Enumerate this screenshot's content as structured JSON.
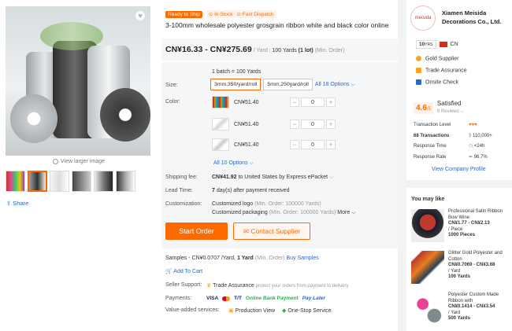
{
  "gallery": {
    "view_larger": "View larger image",
    "share": "Share"
  },
  "product": {
    "badge_ready": "Ready to Ship",
    "badge_stock": "In Stock",
    "badge_dispatch": "Fast Dispatch",
    "title": "3-100mm wholesale polyester grosgrain ribbon white and black color online",
    "price_range": "CN¥16.33 - CN¥275.69",
    "price_unit": "/ Yard",
    "moq_qty": "100 Yards",
    "moq_lot": "(1 lot)",
    "moq_note": "(Min. Order)"
  },
  "options": {
    "batch": "1 batch = 100 Yards",
    "size_label": "Size:",
    "sizes": [
      "3mm,350/yard/roll",
      "5mm,250yard/roll"
    ],
    "all_sizes": "All 18 Options",
    "color_label": "Color:",
    "colors": [
      {
        "price": "CN¥51.40",
        "qty": "0"
      },
      {
        "price": "CN¥51.40",
        "qty": "0"
      },
      {
        "price": "CN¥51.40",
        "qty": "0"
      }
    ],
    "all_colors": "All 10 Options",
    "shipping_label": "Shipping fee:",
    "shipping_price": "CN¥41.92",
    "shipping_text": "to United States by Express ePacket",
    "lead_label": "Lead Time:",
    "lead_days": "7",
    "lead_text": "day(s) after payment received",
    "custom_label": "Customization:",
    "custom_logo": "Customized logo",
    "custom_logo_note": "(Min. Order: 100000 Yards)",
    "custom_pack": "Customized packaging",
    "custom_pack_note": "(Min. Order: 100000 Yards)",
    "more": "More",
    "start_order": "Start Order",
    "contact": "Contact Supplier"
  },
  "lower": {
    "samples": "Samples - CN¥0.0707 /Yard,",
    "samples_qty": "1 Yard",
    "samples_note": "(Min. Order)",
    "buy_samples": "Buy Samples",
    "add_cart": "Add To Cart",
    "seller_label": "Seller Support:",
    "trade": "Trade Assurance",
    "trade_note": "protect your orders from payment to delivery",
    "pay_label": "Payments:",
    "pay_visa": "VISA",
    "pay_tt": "T/T",
    "pay_online": "Online Bank Payment",
    "pay_later": "Pay Later",
    "vas_label": "Value-added services:",
    "vas_prod": "Production View",
    "vas_stop": "One-Stop Service"
  },
  "supplier": {
    "logo_text": "meisida",
    "name": "Xiamen Meisida Decorations Co., Ltd.",
    "years": "10",
    "yrs": "YRS",
    "country": "CN",
    "gold": "Gold Supplier",
    "trade": "Trade Assurance",
    "onsite": "Onsite Check",
    "rating": "4.6",
    "rating_max": "/5",
    "satisfied": "Satisfied",
    "reviews": "9 Reviews",
    "metrics": [
      {
        "label": "Transaction Level",
        "value": ""
      },
      {
        "label": "68 Transactions",
        "value": "110,000+"
      },
      {
        "label": "Response Time",
        "value": "<24h"
      },
      {
        "label": "Response Rate",
        "value": "96.7%"
      }
    ],
    "view_profile": "View Company Profile"
  },
  "you_may_like": {
    "title": "You may like",
    "items": [
      {
        "name": "Professional Satin Ribbon Bow Wine",
        "price": "CN¥1.77 - CN¥2.13",
        "unit": "/ Piece",
        "moq": "1000 Pieces"
      },
      {
        "name": "Glitter Gold Polyester and Cotton",
        "price": "CN¥0.7069 - CN¥3.68",
        "unit": "/ Yard",
        "moq": "100 Yards"
      },
      {
        "name": "Polyester Custom Made Ribbon with",
        "price": "CN¥0.1414 - CN¥3.54",
        "unit": "/ Yard",
        "moq": "500 Yards"
      }
    ]
  },
  "colors": {
    "accent": "#ff6a00",
    "link": "#2a6ac9",
    "green": "#2bb24c"
  }
}
